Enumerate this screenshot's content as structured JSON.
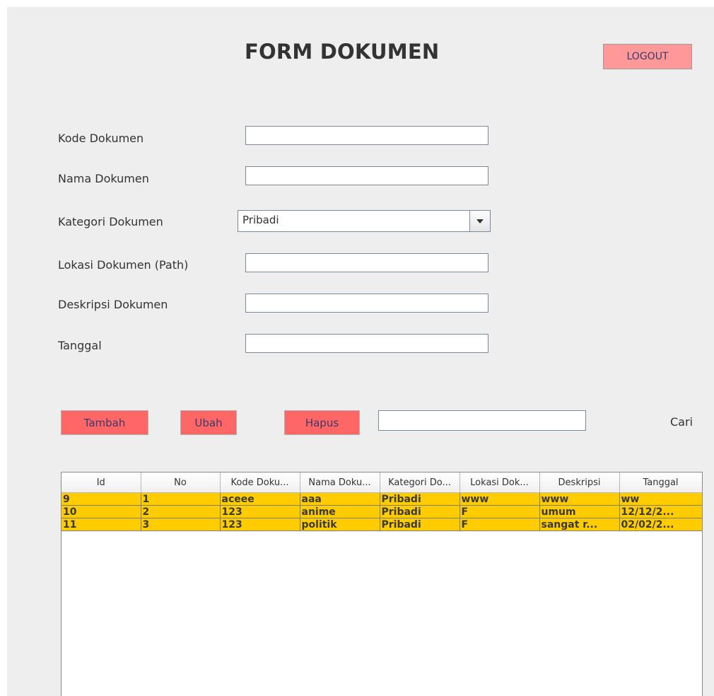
{
  "header": {
    "title": "FORM DOKUMEN",
    "logout_label": "LOGOUT"
  },
  "form": {
    "kode_label": "Kode Dokumen",
    "nama_label": "Nama Dokumen",
    "kategori_label": "Kategori Dokumen",
    "kategori_value": "Pribadi",
    "lokasi_label": "Lokasi Dokumen (Path)",
    "deskripsi_label": "Deskripsi Dokumen",
    "tanggal_label": "Tanggal",
    "kode_value": "",
    "nama_value": "",
    "lokasi_value": "",
    "deskripsi_value": "",
    "tanggal_value": ""
  },
  "actions": {
    "tambah_label": "Tambah",
    "ubah_label": "Ubah",
    "hapus_label": "Hapus",
    "search_value": "",
    "cari_label": "Cari"
  },
  "table": {
    "columns": [
      "Id",
      "No",
      "Kode Doku...",
      "Nama Doku...",
      "Kategori Do...",
      "Lokasi Dok...",
      "Deskripsi",
      "Tanggal"
    ],
    "rows": [
      [
        "9",
        "1",
        "aceee",
        "aaa",
        "Pribadi",
        "www",
        "www",
        "ww"
      ],
      [
        "10",
        "2",
        "123",
        "anime",
        "Pribadi",
        "F",
        "umum",
        "12/12/2..."
      ],
      [
        "11",
        "3",
        "123",
        "politik",
        "Pribadi",
        "F",
        "sangat r...",
        "02/02/2..."
      ]
    ]
  },
  "colors": {
    "background": "#eeeeee",
    "logout_button": "#ff9999",
    "action_button": "#ff6666",
    "selected_row": "#ffcc00"
  }
}
